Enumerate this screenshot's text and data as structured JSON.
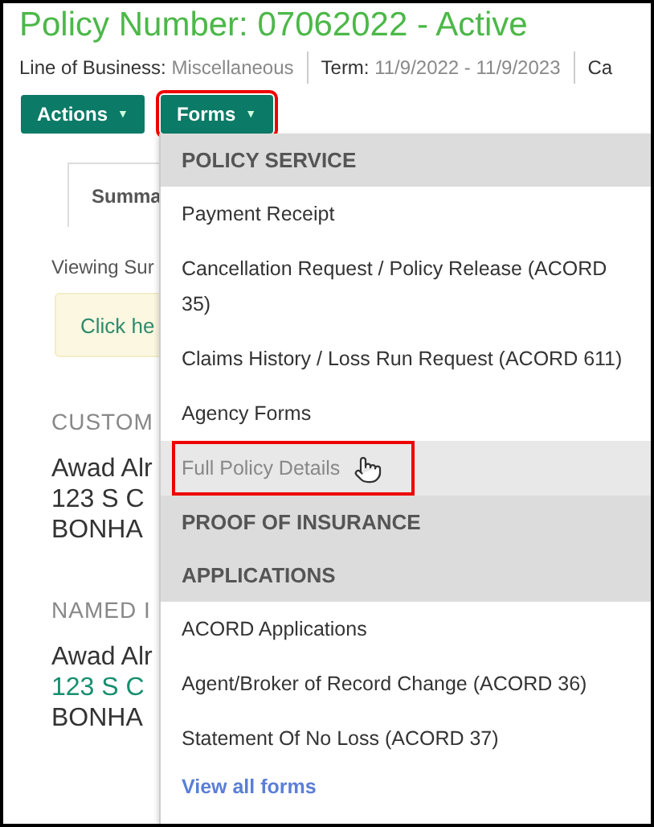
{
  "header": {
    "title": "Policy Number: 07062022 - Active",
    "meta": [
      {
        "label": "Line of Business:",
        "value": "Miscellaneous"
      },
      {
        "label": "Term:",
        "value": "11/9/2022 - 11/9/2023"
      },
      {
        "label": "Ca"
      }
    ]
  },
  "buttons": [
    {
      "label": "Actions",
      "caret": "▼",
      "highlighted": false
    },
    {
      "label": "Forms",
      "caret": "▼",
      "highlighted": true
    }
  ],
  "background": {
    "tab": "Summa",
    "viewing": "Viewing Sur",
    "notice": "Click he",
    "sections": [
      {
        "heading": "CUSTOM",
        "name": "Awad Alr",
        "address": "123 S C",
        "address_link": false,
        "city": "BONHA"
      },
      {
        "heading": "NAMED I",
        "name": "Awad Alr",
        "address": "123 S C",
        "address_link": true,
        "city": "BONHA"
      }
    ]
  },
  "menu": [
    {
      "kind": "header",
      "label": "POLICY SERVICE"
    },
    {
      "kind": "item",
      "label": "Payment Receipt",
      "highlighted": false
    },
    {
      "kind": "item",
      "label": "Cancellation Request / Policy Release (ACORD 35)",
      "highlighted": false
    },
    {
      "kind": "item",
      "label": "Claims History / Loss Run Request (ACORD 611)",
      "highlighted": false
    },
    {
      "kind": "item",
      "label": "Agency Forms",
      "highlighted": false
    },
    {
      "kind": "item",
      "label": "Full Policy Details",
      "highlighted": true
    },
    {
      "kind": "header",
      "label": "PROOF OF INSURANCE"
    },
    {
      "kind": "header",
      "label": "APPLICATIONS"
    },
    {
      "kind": "item",
      "label": "ACORD Applications",
      "highlighted": false
    },
    {
      "kind": "item",
      "label": "Agent/Broker of Record Change (ACORD 36)",
      "highlighted": false
    },
    {
      "kind": "item",
      "label": "Statement Of No Loss (ACORD 37)",
      "highlighted": false
    },
    {
      "kind": "link",
      "label": "View all forms"
    }
  ]
}
